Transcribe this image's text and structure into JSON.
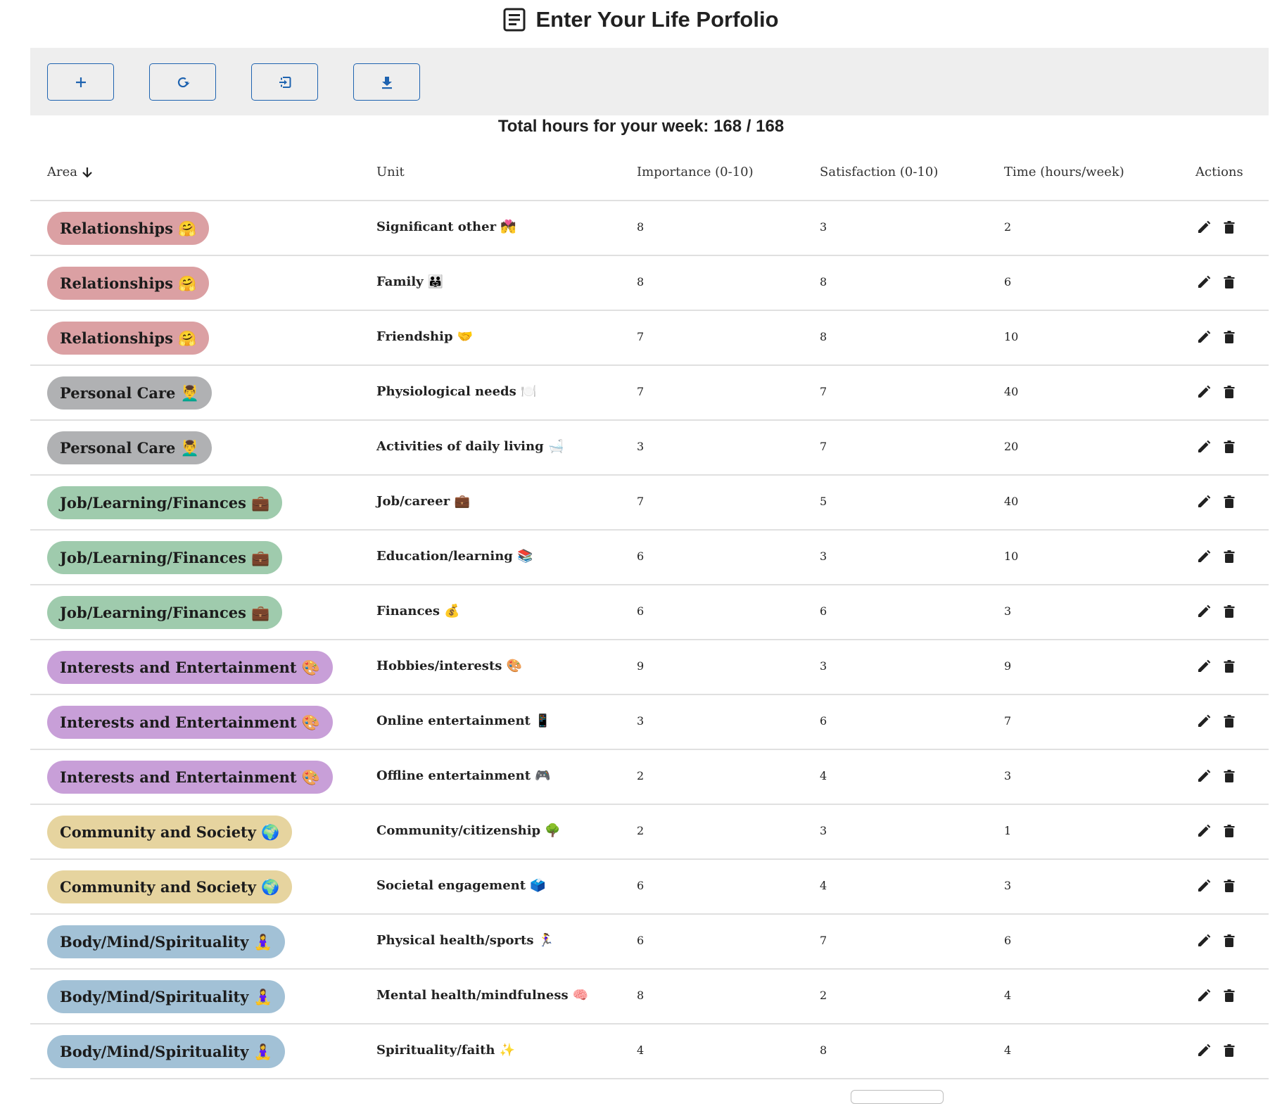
{
  "header": {
    "title": "Enter Your Life Porfolio",
    "title_icon": "notes-icon"
  },
  "toolbar": {
    "buttons": [
      {
        "name": "add",
        "icon": "plus-icon"
      },
      {
        "name": "reset",
        "icon": "refresh-icon"
      },
      {
        "name": "import",
        "icon": "import-icon"
      },
      {
        "name": "download",
        "icon": "download-icon"
      }
    ],
    "accent_color": "#1e63b0"
  },
  "summary": {
    "total_hours_text": "Total hours for your week: 168 / 168",
    "total_hours": 168,
    "max_hours": 168
  },
  "table": {
    "columns": {
      "area": "Area",
      "unit": "Unit",
      "importance": "Importance (0-10)",
      "satisfaction": "Satisfaction (0-10)",
      "time": "Time (hours/week)",
      "actions": "Actions"
    },
    "sort": {
      "column": "area",
      "direction": "descending",
      "icon": "arrow-down-icon"
    },
    "area_colors": {
      "Relationships": "#dba0a3",
      "Personal Care": "#b0b1b3",
      "Job/Learning/Finances": "#9fcbad",
      "Interests and Entertainment": "#c89fd8",
      "Community and Society": "#e6d49f",
      "Body/Mind/Spirituality": "#a2c1d6"
    },
    "rows": [
      {
        "area": "Relationships 🤗",
        "area_key": "Relationships",
        "unit": "Significant other 💏",
        "importance": "8",
        "satisfaction": "3",
        "time": "2"
      },
      {
        "area": "Relationships 🤗",
        "area_key": "Relationships",
        "unit": "Family 👨‍👨‍👧",
        "importance": "8",
        "satisfaction": "8",
        "time": "6"
      },
      {
        "area": "Relationships 🤗",
        "area_key": "Relationships",
        "unit": "Friendship 🤝",
        "importance": "7",
        "satisfaction": "8",
        "time": "10"
      },
      {
        "area": "Personal Care 💆‍♂️",
        "area_key": "Personal Care",
        "unit": "Physiological needs 🍽️",
        "importance": "7",
        "satisfaction": "7",
        "time": "40"
      },
      {
        "area": "Personal Care 💆‍♂️",
        "area_key": "Personal Care",
        "unit": "Activities of daily living 🛁",
        "importance": "3",
        "satisfaction": "7",
        "time": "20"
      },
      {
        "area": "Job/Learning/Finances 💼",
        "area_key": "Job/Learning/Finances",
        "unit": "Job/career 💼",
        "importance": "7",
        "satisfaction": "5",
        "time": "40"
      },
      {
        "area": "Job/Learning/Finances 💼",
        "area_key": "Job/Learning/Finances",
        "unit": "Education/learning 📚",
        "importance": "6",
        "satisfaction": "3",
        "time": "10"
      },
      {
        "area": "Job/Learning/Finances 💼",
        "area_key": "Job/Learning/Finances",
        "unit": "Finances 💰",
        "importance": "6",
        "satisfaction": "6",
        "time": "3"
      },
      {
        "area": "Interests and Entertainment 🎨",
        "area_key": "Interests and Entertainment",
        "unit": "Hobbies/interests 🎨",
        "importance": "9",
        "satisfaction": "3",
        "time": "9"
      },
      {
        "area": "Interests and Entertainment 🎨",
        "area_key": "Interests and Entertainment",
        "unit": "Online entertainment 📱",
        "importance": "3",
        "satisfaction": "6",
        "time": "7"
      },
      {
        "area": "Interests and Entertainment 🎨",
        "area_key": "Interests and Entertainment",
        "unit": "Offline entertainment 🎮",
        "importance": "2",
        "satisfaction": "4",
        "time": "3"
      },
      {
        "area": "Community and Society 🌍",
        "area_key": "Community and Society",
        "unit": "Community/citizenship 🌳",
        "importance": "2",
        "satisfaction": "3",
        "time": "1"
      },
      {
        "area": "Community and Society 🌍",
        "area_key": "Community and Society",
        "unit": "Societal engagement 🗳️",
        "importance": "6",
        "satisfaction": "4",
        "time": "3"
      },
      {
        "area": "Body/Mind/Spirituality 🧘‍♀️",
        "area_key": "Body/Mind/Spirituality",
        "unit": "Physical health/sports 🏃‍♀️",
        "importance": "6",
        "satisfaction": "7",
        "time": "6"
      },
      {
        "area": "Body/Mind/Spirituality 🧘‍♀️",
        "area_key": "Body/Mind/Spirituality",
        "unit": "Mental health/mindfulness 🧠",
        "importance": "8",
        "satisfaction": "2",
        "time": "4"
      },
      {
        "area": "Body/Mind/Spirituality 🧘‍♀️",
        "area_key": "Body/Mind/Spirituality",
        "unit": "Spirituality/faith ✨",
        "importance": "4",
        "satisfaction": "8",
        "time": "4"
      }
    ],
    "row_actions": [
      {
        "name": "edit",
        "icon": "pencil-icon"
      },
      {
        "name": "delete",
        "icon": "trash-icon"
      }
    ]
  }
}
